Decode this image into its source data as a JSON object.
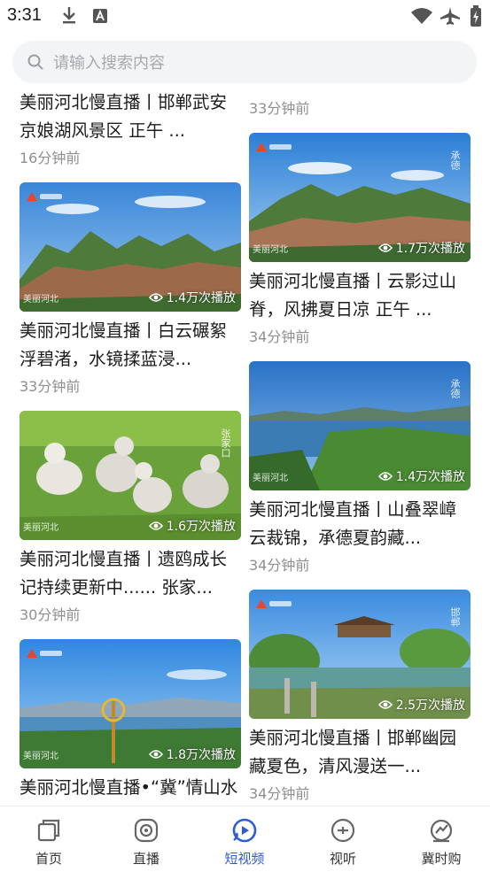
{
  "status_bar": {
    "time": "3:31"
  },
  "search": {
    "placeholder": "请输入搜索内容"
  },
  "colors": {
    "accent": "#2f5bd6",
    "text": "#1c1c1c",
    "muted": "#8f8f8f"
  },
  "feed": {
    "left": [
      {
        "title": "美丽河北慢直播丨邯郸武安 京娘湖风景区 正午 ...",
        "time": "16分钟前"
      },
      {
        "title": "美丽河北慢直播丨白云碾絮浮碧渚，水镜揉蓝浸...",
        "time": "33分钟前",
        "views": "1.4万次播放"
      },
      {
        "title": "美丽河北慢直播丨遗鸥成长记持续更新中...... 张家...",
        "time": "30分钟前",
        "views": "1.6万次播放"
      },
      {
        "title": "美丽河北慢直播•“冀”情山水丨夏趣大行，湖光山...",
        "views": "1.8万次播放"
      }
    ],
    "right": [
      {
        "time": "33分钟前"
      },
      {
        "title": "美丽河北慢直播丨云影过山脊，风拂夏日凉 正午 ...",
        "time": "34分钟前",
        "views": "1.7万次播放"
      },
      {
        "title": "美丽河北慢直播丨山叠翠嶂云裁锦，承德夏韵藏...",
        "time": "34分钟前",
        "views": "1.4万次播放"
      },
      {
        "title": "美丽河北慢直播丨邯郸幽园藏夏色，清风漫送一...",
        "time": "34分钟前",
        "views": "2.5万次播放"
      }
    ]
  },
  "tabs": [
    {
      "label": "首页",
      "icon": "home-icon"
    },
    {
      "label": "直播",
      "icon": "live-icon"
    },
    {
      "label": "短视频",
      "icon": "short-video-icon",
      "active": true
    },
    {
      "label": "视听",
      "icon": "listen-icon"
    },
    {
      "label": "冀时购",
      "icon": "shop-icon"
    }
  ]
}
